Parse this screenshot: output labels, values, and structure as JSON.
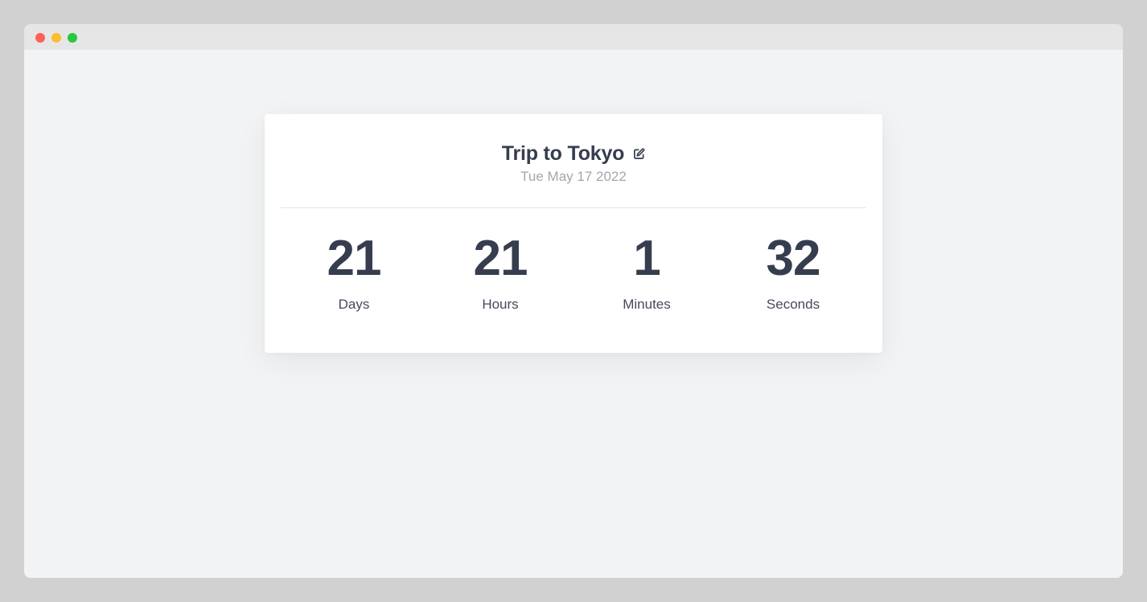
{
  "window": {
    "controls": {
      "close_color": "#fe5f57",
      "minimize_color": "#febc2e",
      "zoom_color": "#28c840"
    }
  },
  "countdown": {
    "title": "Trip to Tokyo",
    "edit_icon": "edit-icon",
    "date": "Tue May 17 2022",
    "units": [
      {
        "value": "21",
        "label": "Days"
      },
      {
        "value": "21",
        "label": "Hours"
      },
      {
        "value": "1",
        "label": "Minutes"
      },
      {
        "value": "32",
        "label": "Seconds"
      }
    ]
  },
  "colors": {
    "text_primary": "#363d4e",
    "text_muted": "#a3a6ad",
    "background": "#f2f3f5",
    "card": "#ffffff"
  }
}
